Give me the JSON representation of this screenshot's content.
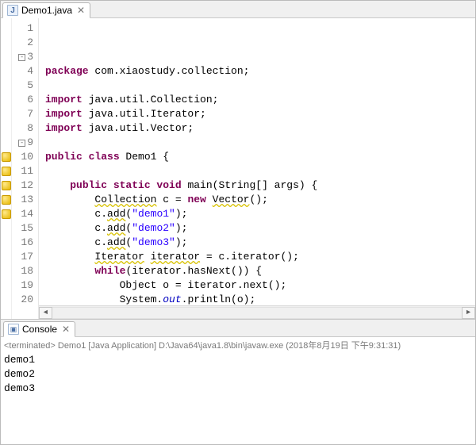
{
  "editor": {
    "tab": {
      "filename": "Demo1.java"
    },
    "foldable_lines": [
      3,
      9
    ],
    "warning_lines": [
      10,
      11,
      12,
      13,
      14
    ],
    "current_line": 20,
    "lines": [
      {
        "n": 1,
        "tokens": [
          [
            "kw",
            "package"
          ],
          [
            "",
            " com.xiaostudy.collection;"
          ]
        ]
      },
      {
        "n": 2,
        "tokens": [
          [
            "",
            ""
          ]
        ]
      },
      {
        "n": 3,
        "tokens": [
          [
            "kw",
            "import"
          ],
          [
            "",
            " java.util.Collection;"
          ]
        ]
      },
      {
        "n": 4,
        "tokens": [
          [
            "kw",
            "import"
          ],
          [
            "",
            " java.util.Iterator;"
          ]
        ]
      },
      {
        "n": 5,
        "tokens": [
          [
            "kw",
            "import"
          ],
          [
            "",
            " java.util.Vector;"
          ]
        ]
      },
      {
        "n": 6,
        "tokens": [
          [
            "",
            ""
          ]
        ]
      },
      {
        "n": 7,
        "tokens": [
          [
            "kw",
            "public class"
          ],
          [
            "",
            " Demo1 {"
          ]
        ]
      },
      {
        "n": 8,
        "tokens": [
          [
            "",
            ""
          ]
        ]
      },
      {
        "n": 9,
        "tokens": [
          [
            "",
            "    "
          ],
          [
            "kw",
            "public static void"
          ],
          [
            "",
            " main(String[] args) {"
          ]
        ]
      },
      {
        "n": 10,
        "tokens": [
          [
            "",
            "        "
          ],
          [
            "warn",
            "Collection"
          ],
          [
            "",
            " c = "
          ],
          [
            "kw",
            "new"
          ],
          [
            "",
            " "
          ],
          [
            "warn",
            "Vector"
          ],
          [
            "",
            "();"
          ]
        ]
      },
      {
        "n": 11,
        "tokens": [
          [
            "",
            "        c."
          ],
          [
            "warn",
            "add"
          ],
          [
            "",
            "("
          ],
          [
            "str",
            "\"demo1\""
          ],
          [
            "",
            ");"
          ]
        ]
      },
      {
        "n": 12,
        "tokens": [
          [
            "",
            "        c."
          ],
          [
            "warn",
            "add"
          ],
          [
            "",
            "("
          ],
          [
            "str",
            "\"demo2\""
          ],
          [
            "",
            ");"
          ]
        ]
      },
      {
        "n": 13,
        "tokens": [
          [
            "",
            "        c."
          ],
          [
            "warn",
            "add"
          ],
          [
            "",
            "("
          ],
          [
            "str",
            "\"demo3\""
          ],
          [
            "",
            ");"
          ]
        ]
      },
      {
        "n": 14,
        "tokens": [
          [
            "",
            "        "
          ],
          [
            "warn",
            "Iterator"
          ],
          [
            "",
            " "
          ],
          [
            "warn",
            "iterator"
          ],
          [
            "",
            " = c.iterator();"
          ]
        ]
      },
      {
        "n": 15,
        "tokens": [
          [
            "",
            "        "
          ],
          [
            "kw",
            "while"
          ],
          [
            "",
            "(iterator.hasNext()) {"
          ]
        ]
      },
      {
        "n": 16,
        "tokens": [
          [
            "",
            "            Object o = iterator.next();"
          ]
        ]
      },
      {
        "n": 17,
        "tokens": [
          [
            "",
            "            System."
          ],
          [
            "sfld",
            "out"
          ],
          [
            "",
            ".println(o);"
          ]
        ]
      },
      {
        "n": 18,
        "tokens": [
          [
            "",
            "        }"
          ]
        ]
      },
      {
        "n": 19,
        "tokens": [
          [
            "",
            "    }"
          ]
        ]
      },
      {
        "n": 20,
        "tokens": [
          [
            "",
            ""
          ]
        ]
      }
    ]
  },
  "console": {
    "tab_label": "Console",
    "status": "<terminated> Demo1 [Java Application] D:\\Java64\\java1.8\\bin\\javaw.exe (2018年8月19日 下午9:31:31)",
    "output": [
      "demo1",
      "demo2",
      "demo3"
    ]
  }
}
